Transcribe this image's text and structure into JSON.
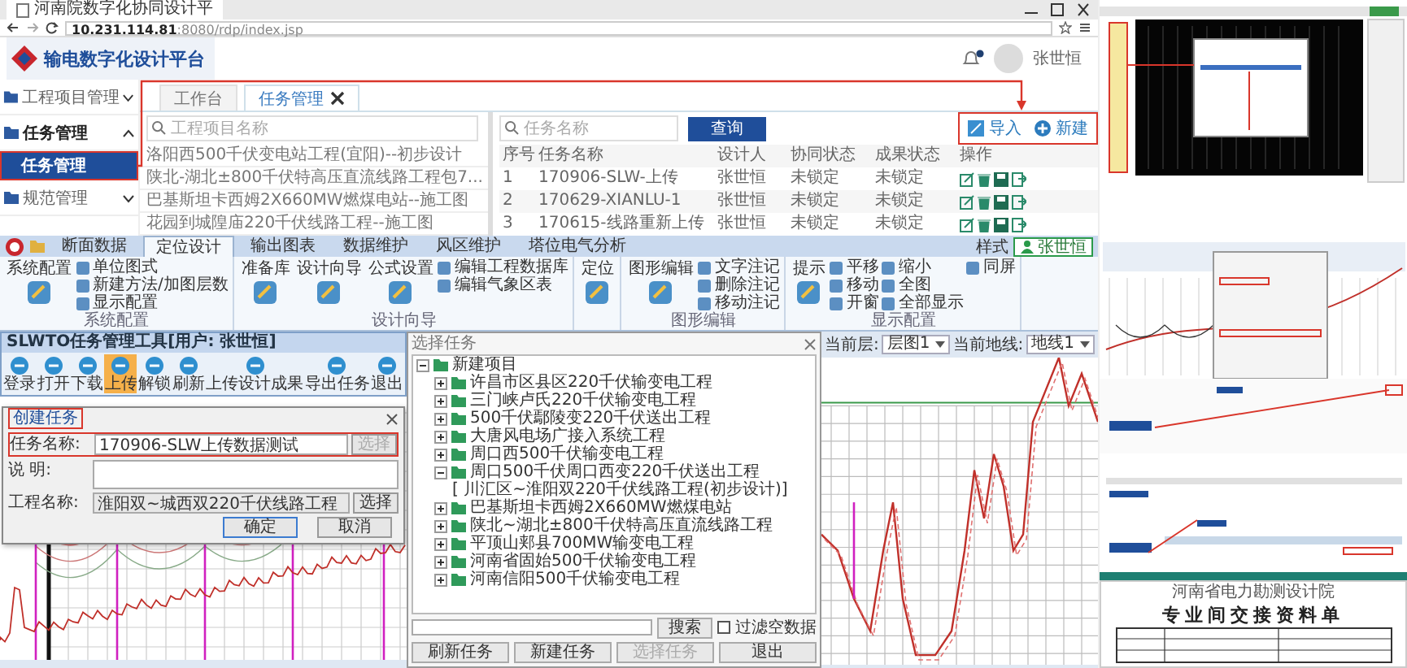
{
  "browser": {
    "tab_title": "河南院数字化协同设计平",
    "url": "**10.231.114.81**:8080/rdp/index.jsp"
  },
  "web_app": {
    "logo_text": "输电数字化设计平台",
    "user": "张世恒",
    "sidebar": [
      {
        "label": "工程项目管理",
        "expanded": false
      },
      {
        "label": "任务管理",
        "expanded": true,
        "children": [
          {
            "label": "任务管理",
            "selected": true
          }
        ]
      },
      {
        "label": "规范管理",
        "expanded": false
      }
    ],
    "tabs": [
      {
        "label": "工作台",
        "selected": false,
        "closable": false
      },
      {
        "label": "任务管理",
        "selected": true,
        "closable": true
      }
    ],
    "project_search": {
      "placeholder": "工程项目名称"
    },
    "task_search": {
      "placeholder": "任务名称"
    },
    "query_button": "查询",
    "actions": [
      {
        "kind": "import",
        "label": "导入"
      },
      {
        "kind": "new",
        "label": "新建"
      }
    ],
    "projects": [
      "洛阳西500千伏变电站工程(宜阳)--初步设计",
      "陕北-湖北±800千伏特高压直流线路工程包7...",
      "巴基斯坦卡西姆2X660MW燃煤电站--施工图",
      "花园到城隍庙220千伏线路工程--施工图"
    ],
    "table": {
      "columns": [
        "序号",
        "任务名称",
        "设计人",
        "协同状态",
        "成果状态",
        "操作"
      ],
      "rows": [
        {
          "cells": [
            "1",
            "170906-SLW-上传",
            "张世恒",
            "未锁定",
            "未锁定"
          ]
        },
        {
          "cells": [
            "2",
            "170629-XIANLU-1",
            "张世恒",
            "未锁定",
            "未锁定"
          ]
        },
        {
          "cells": [
            "3",
            "170615-线路重新上传",
            "张世恒",
            "未锁定",
            "未锁定"
          ]
        }
      ]
    }
  },
  "desktop_app": {
    "ribbon_tabs": [
      {
        "label": "断面数据",
        "selected": false
      },
      {
        "label": "定位设计",
        "selected": true
      },
      {
        "label": "输出图表",
        "selected": false
      },
      {
        "label": "数据维护",
        "selected": false
      },
      {
        "label": "风区维护",
        "selected": false
      },
      {
        "label": "塔位电气分析",
        "selected": false
      }
    ],
    "style_label": "样式",
    "user": "张世恒",
    "ribbon_groups": [
      {
        "label": "系统配置",
        "items": [
          {
            "kind": "large",
            "label": "系统配置"
          },
          {
            "kind": "small",
            "label": "单位图式"
          },
          {
            "kind": "small",
            "label": "新建方法/加图层数"
          },
          {
            "kind": "small",
            "label": "显示配置"
          }
        ]
      },
      {
        "label": "设计向导",
        "items": [
          {
            "kind": "large",
            "label": "准备库"
          },
          {
            "kind": "large",
            "label": "设计向导"
          },
          {
            "kind": "large",
            "label": "公式设置"
          },
          {
            "kind": "small",
            "label": "编辑工程数据库"
          },
          {
            "kind": "small",
            "label": "编辑气象区表"
          }
        ]
      },
      {
        "items": [
          {
            "kind": "large",
            "label": "定位"
          }
        ]
      },
      {
        "label": "图形编辑",
        "items": [
          {
            "kind": "large",
            "label": "图形编辑"
          },
          {
            "kind": "small",
            "label": "文字注记"
          },
          {
            "kind": "small",
            "label": "删除注记"
          },
          {
            "kind": "small",
            "label": "移动注记"
          }
        ]
      },
      {
        "label": "显示配置",
        "items": [
          {
            "kind": "large",
            "label": "提示"
          },
          {
            "kind": "small",
            "label": "平移"
          },
          {
            "kind": "small",
            "label": "移动"
          },
          {
            "kind": "small",
            "label": "开窗"
          },
          {
            "kind": "small",
            "label": "缩小"
          },
          {
            "kind": "small",
            "label": "全图"
          },
          {
            "kind": "small",
            "label": "全部显示"
          },
          {
            "kind": "small",
            "label": "同屏"
          }
        ]
      }
    ],
    "task_tool": {
      "title": "SLWTO任务管理工具[用户: 张世恒]",
      "buttons": [
        {
          "label": "登录",
          "selected": false
        },
        {
          "label": "打开",
          "selected": false
        },
        {
          "label": "下载",
          "selected": false
        },
        {
          "label": "上传",
          "selected": true
        },
        {
          "label": "解锁",
          "selected": false
        },
        {
          "label": "刷新",
          "selected": false
        },
        {
          "label": "上传设计成果",
          "selected": false
        },
        {
          "label": "导出任务",
          "selected": false
        },
        {
          "label": "退出",
          "selected": false
        }
      ]
    },
    "layer_bar": {
      "layer_label": "当前层:",
      "layer_value": "层图1",
      "ground_label": "当前地线:",
      "ground_value": "地线1"
    },
    "task_dialog": {
      "title": "选择任务",
      "tree": {
        "label": "新建项目",
        "expanded": true,
        "children": [
          {
            "label": "许昌市区县区220千伏输变电工程",
            "expanded": false
          },
          {
            "label": "三门峡卢氏220千伏输变电工程",
            "expanded": false
          },
          {
            "label": "500千伏鄢陵变220千伏送出工程",
            "expanded": false
          },
          {
            "label": "大唐风电场广接入系统工程",
            "expanded": false
          },
          {
            "label": "周口西500千伏输变电工程",
            "expanded": false
          },
          {
            "label": "周口500千伏周口西变220千伏送出工程",
            "expanded": true,
            "children": [
              {
                "label": "[ 川汇区~淮阳双220千伏线路工程(初步设计)]"
              }
            ]
          },
          {
            "label": "巴基斯坦卡西姆2X660MW燃煤电站",
            "expanded": false
          },
          {
            "label": "陕北~湖北±800千伏特高压直流线路工程",
            "expanded": false
          },
          {
            "label": "平顶山郏县700MW输变电工程",
            "expanded": false
          },
          {
            "label": "河南省固始500千伏输变电工程",
            "expanded": false
          },
          {
            "label": "河南信阳500千伏输变电工程",
            "expanded": false
          }
        ]
      },
      "search_button": "搜索",
      "filter": {
        "label": "过滤空数据",
        "checked": false
      },
      "buttons": [
        {
          "label": "刷新任务",
          "disabled": false
        },
        {
          "label": "新建任务",
          "disabled": false
        },
        {
          "label": "选择任务",
          "disabled": true
        },
        {
          "label": "退出",
          "disabled": false
        }
      ]
    },
    "create_dialog": {
      "title": "创建任务",
      "name_label": "任务名称:",
      "name_value": "170906-SLW上传数据测试",
      "name_button": {
        "label": "选择",
        "disabled": true
      },
      "description_label": "说 明:",
      "project_label": "工程名称:",
      "project_value": "淮阳双~城西双220千伏线路工程",
      "project_button": {
        "label": "选择",
        "disabled": false
      },
      "buttons": [
        "确定",
        "取消"
      ]
    }
  },
  "thumbnails": [
    {
      "kind": "cad"
    },
    {
      "kind": "profile"
    },
    {
      "kind": "form",
      "heading": "河南省电力勘测设计院",
      "title": "专业间交接资料单"
    }
  ]
}
